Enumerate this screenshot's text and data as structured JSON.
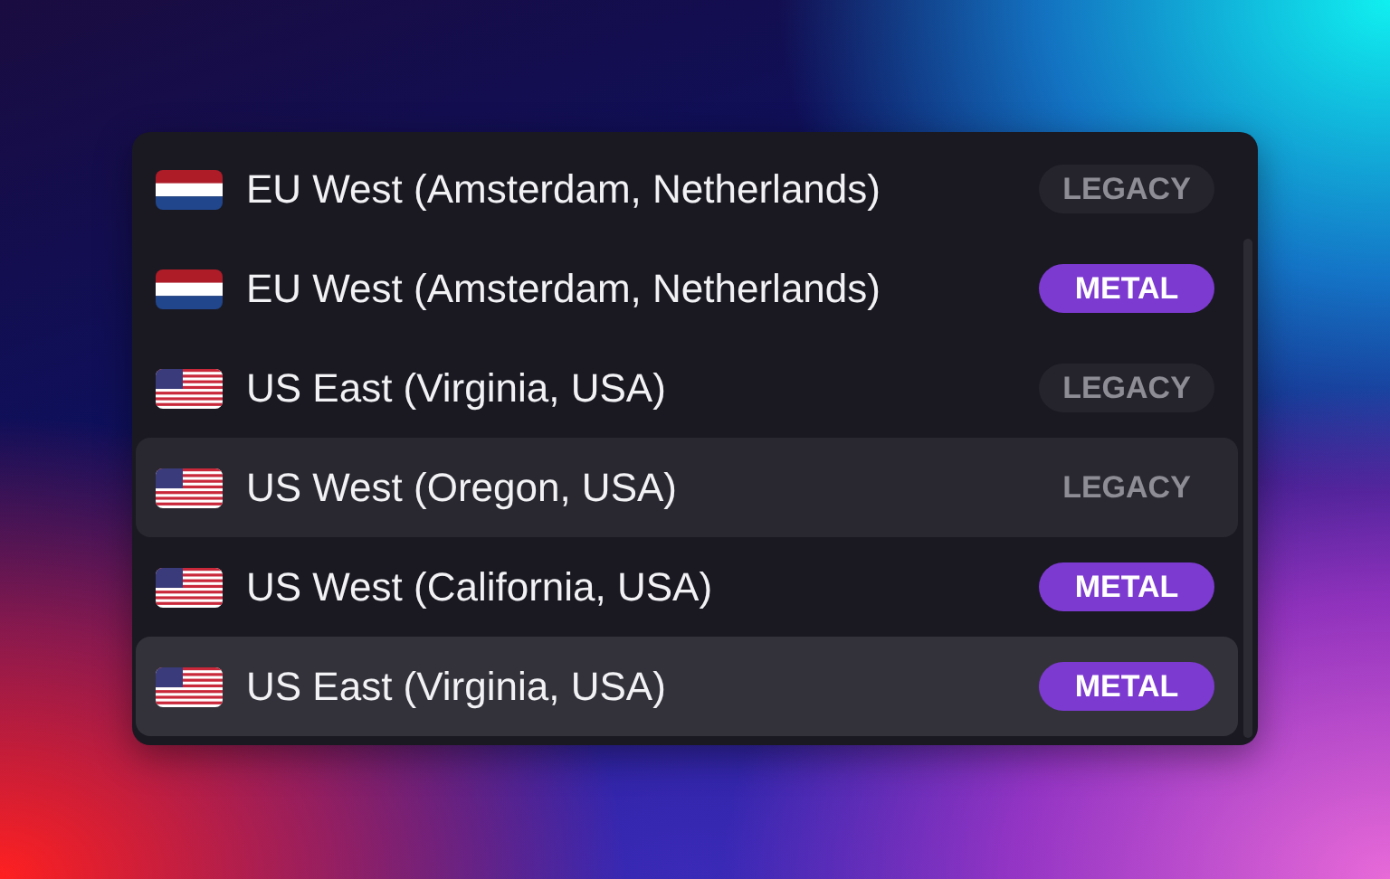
{
  "regions": [
    {
      "kind": "nl",
      "name": "EU West (Amsterdam, Netherlands)",
      "badge": {
        "kind": "legacy",
        "label": "LEGACY"
      },
      "hovered": false,
      "selected": false
    },
    {
      "kind": "nl",
      "name": "EU West (Amsterdam, Netherlands)",
      "badge": {
        "kind": "metal",
        "label": "METAL"
      },
      "hovered": false,
      "selected": false
    },
    {
      "kind": "us",
      "name": "US East (Virginia, USA)",
      "badge": {
        "kind": "legacy",
        "label": "LEGACY"
      },
      "hovered": false,
      "selected": false
    },
    {
      "kind": "us",
      "name": "US West (Oregon, USA)",
      "badge": {
        "kind": "legacy",
        "label": "LEGACY"
      },
      "hovered": true,
      "selected": false
    },
    {
      "kind": "us",
      "name": "US West (California, USA)",
      "badge": {
        "kind": "metal",
        "label": "METAL"
      },
      "hovered": false,
      "selected": false
    },
    {
      "kind": "us",
      "name": "US East (Virginia, USA)",
      "badge": {
        "kind": "metal",
        "label": "METAL"
      },
      "hovered": false,
      "selected": true
    }
  ]
}
